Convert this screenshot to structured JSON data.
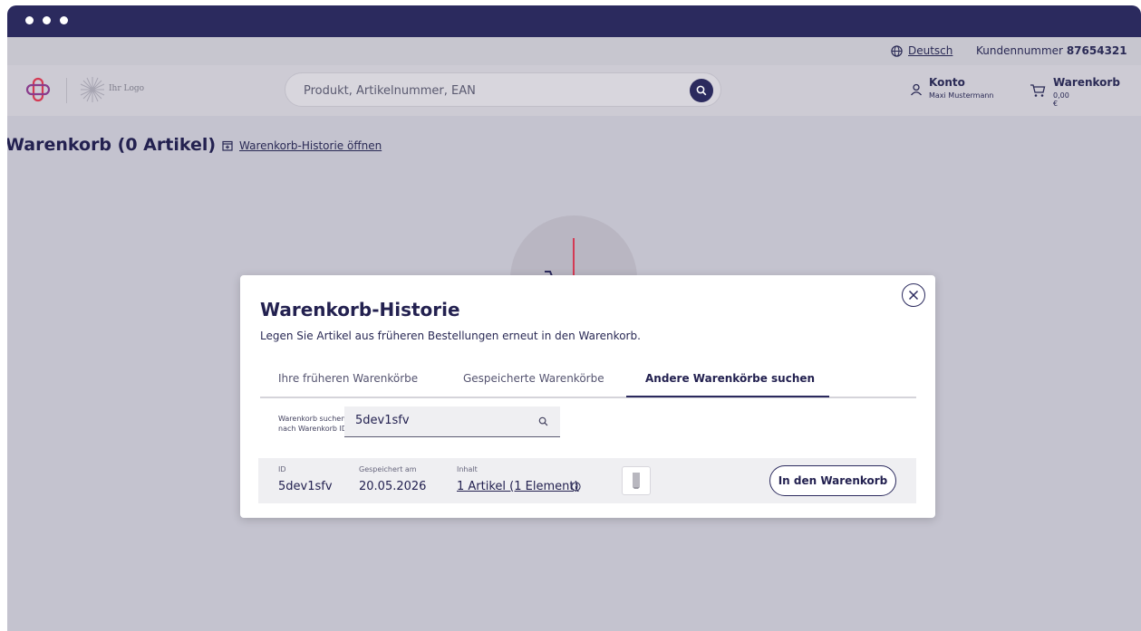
{
  "topbar": {
    "language": "Deutsch",
    "customer_label": "Kundennummer",
    "customer_number": "87654321"
  },
  "header": {
    "logo_text": "Ihr Logo",
    "search_placeholder": "Produkt, Artikelnummer, EAN",
    "account_title": "Konto",
    "account_name": "Maxi Mustermann",
    "cart_title": "Warenkorb",
    "cart_total": "0,00 €"
  },
  "page": {
    "title": "Warenkorb (0 Artikel)",
    "history_link": "Warenkorb-Historie öffnen"
  },
  "modal": {
    "title": "Warenkorb-Historie",
    "subtitle": "Legen Sie Artikel aus früheren Bestellungen erneut in den Warenkorb.",
    "tabs": [
      {
        "label": "Ihre früheren Warenkörbe",
        "active": false
      },
      {
        "label": "Gespeicherte Warenkörbe",
        "active": false
      },
      {
        "label": "Andere Warenkörbe suchen",
        "active": true
      }
    ],
    "search_label_1": "Warenkorb suchen",
    "search_label_2": "nach Warenkorb ID",
    "search_value": "5dev1sfv",
    "result": {
      "id_label": "ID",
      "id_value": "5dev1sfv",
      "saved_label": "Gespeichert am",
      "saved_value": "20.05.2026",
      "content_label": "Inhalt",
      "content_value": "1 Artikel (1 Element)",
      "add_button": "In den Warenkorb"
    }
  },
  "colors": {
    "navy": "#2b2a5e",
    "brand_red": "#d43a54",
    "brand_purple": "#8a3c8c"
  },
  "icons": [
    "globe-icon",
    "brand-cross-icon",
    "sunburst-logo-icon",
    "search-icon",
    "user-icon",
    "cart-icon",
    "history-icon",
    "close-icon",
    "info-icon",
    "product-thumbnail-icon"
  ]
}
